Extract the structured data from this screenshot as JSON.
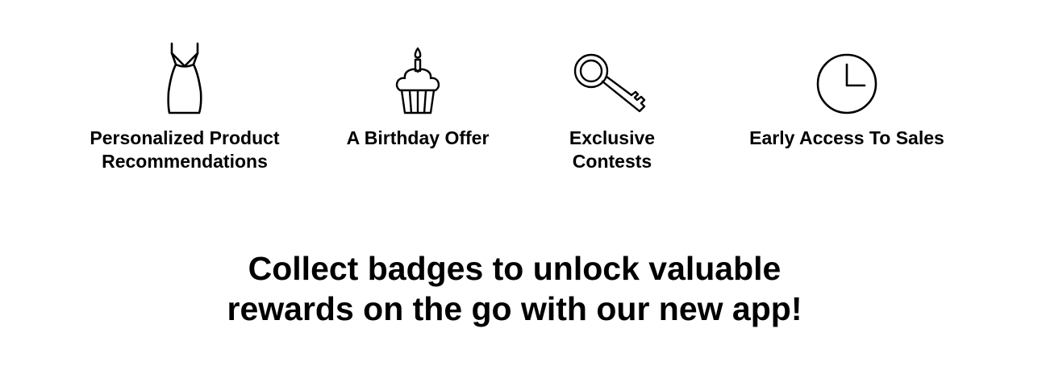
{
  "benefits": [
    {
      "icon": "dress-icon",
      "label": "Personalized Product\nRecommendations"
    },
    {
      "icon": "cupcake-icon",
      "label": "A Birthday Offer"
    },
    {
      "icon": "key-icon",
      "label": "Exclusive\nContests"
    },
    {
      "icon": "clock-icon",
      "label": "Early Access To Sales"
    }
  ],
  "headline": "Collect badges to unlock valuable\nrewards on the go with our new app!",
  "colors": {
    "text": "#000000",
    "background": "#ffffff"
  }
}
